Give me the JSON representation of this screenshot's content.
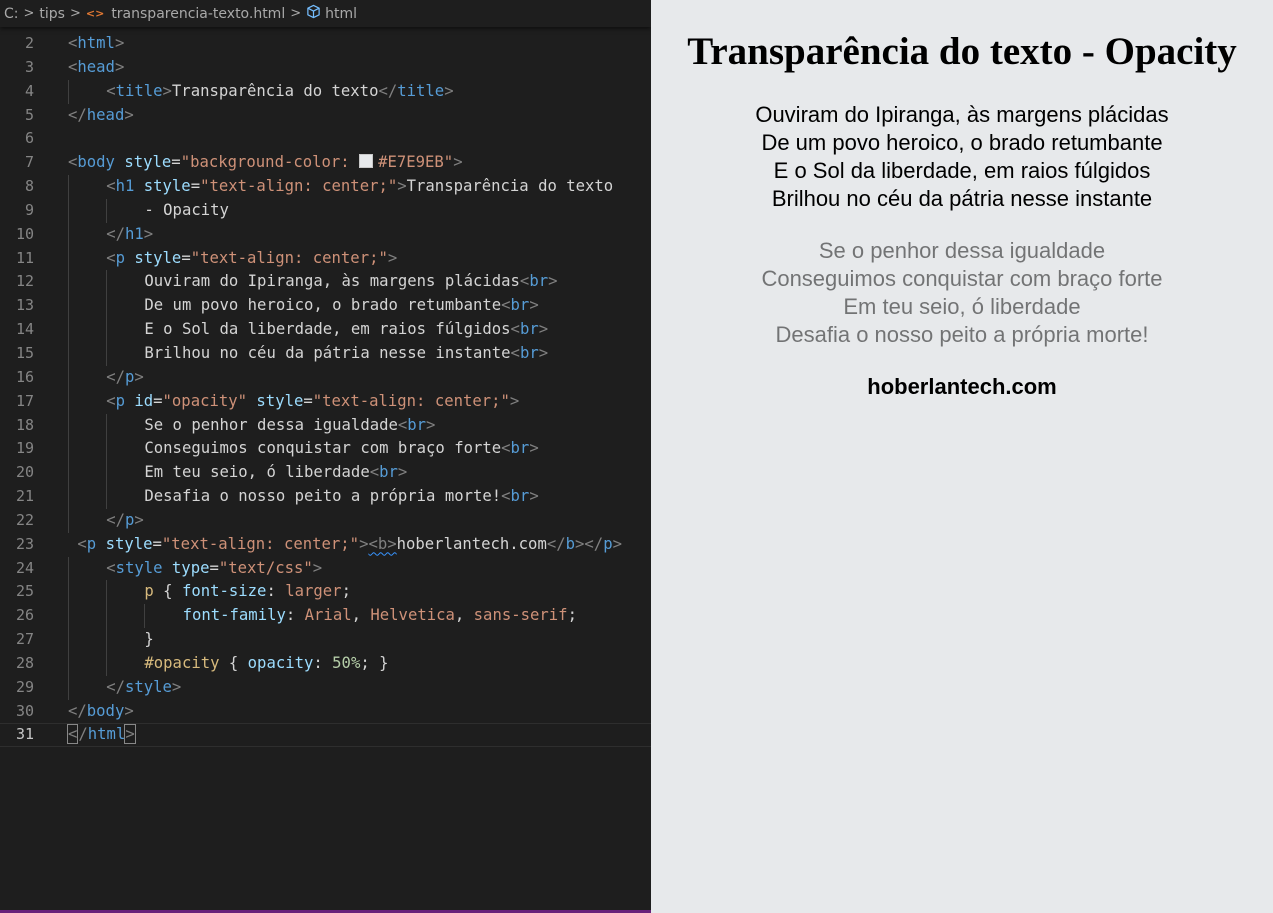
{
  "breadcrumb": {
    "drive": "C:",
    "folder": "tips",
    "file": "transparencia-texto.html",
    "symbol": "html"
  },
  "preview": {
    "heading": "Transparência do texto - Opacity",
    "stanza1": [
      "Ouviram do Ipiranga, às margens plácidas",
      "De um povo heroico, o brado retumbante",
      "E o Sol da liberdade, em raios fúlgidos",
      "Brilhou no céu da pátria nesse instante"
    ],
    "stanza2": [
      "Se o penhor dessa igualdade",
      "Conseguimos conquistar com braço forte",
      "Em teu seio, ó liberdade",
      "Desafia o nosso peito a própria morte!"
    ],
    "footer": "hoberlantech.com"
  },
  "colors": {
    "editor_bg": "#1e1e1e",
    "preview_bg": "#E7E9EB",
    "tag": "#569cd6",
    "attr": "#9cdcfe",
    "string": "#ce9178",
    "selector": "#d7ba7d"
  },
  "editor": {
    "current_line": 31,
    "lines": [
      {
        "n": "2",
        "i": 0,
        "tokens": [
          [
            "t-punc",
            "<"
          ],
          [
            "t-tag",
            "html"
          ],
          [
            "t-punc",
            ">"
          ]
        ]
      },
      {
        "n": "3",
        "i": 0,
        "tokens": [
          [
            "t-punc",
            "<"
          ],
          [
            "t-tag",
            "head"
          ],
          [
            "t-punc",
            ">"
          ]
        ]
      },
      {
        "n": "4",
        "i": 1,
        "tokens": [
          [
            "t-punc",
            "<"
          ],
          [
            "t-tag",
            "title"
          ],
          [
            "t-punc",
            ">"
          ],
          [
            "t-text",
            "Transparência do texto"
          ],
          [
            "t-punc",
            "</"
          ],
          [
            "t-tag",
            "title"
          ],
          [
            "t-punc",
            ">"
          ]
        ]
      },
      {
        "n": "5",
        "i": 0,
        "tokens": [
          [
            "t-punc",
            "</"
          ],
          [
            "t-tag",
            "head"
          ],
          [
            "t-punc",
            ">"
          ]
        ]
      },
      {
        "n": "6",
        "i": 0,
        "tokens": []
      },
      {
        "n": "7",
        "i": 0,
        "tokens": [
          [
            "t-punc",
            "<"
          ],
          [
            "t-tag",
            "body"
          ],
          [
            "t-text",
            " "
          ],
          [
            "t-attr",
            "style"
          ],
          [
            "t-text",
            "="
          ],
          [
            "t-str",
            "\"background-color: "
          ],
          [
            "swatch",
            ""
          ],
          [
            "t-str",
            "#E7E9EB\""
          ],
          [
            "t-punc",
            ">"
          ]
        ]
      },
      {
        "n": "8",
        "i": 1,
        "tokens": [
          [
            "t-punc",
            "<"
          ],
          [
            "t-tag",
            "h1"
          ],
          [
            "t-text",
            " "
          ],
          [
            "t-attr",
            "style"
          ],
          [
            "t-text",
            "="
          ],
          [
            "t-str",
            "\"text-align: center;\""
          ],
          [
            "t-punc",
            ">"
          ],
          [
            "t-text",
            "Transparência do texto"
          ]
        ]
      },
      {
        "n": "9",
        "i": 2,
        "tokens": [
          [
            "t-text",
            "- Opacity"
          ]
        ]
      },
      {
        "n": "10",
        "i": 1,
        "tokens": [
          [
            "t-punc",
            "</"
          ],
          [
            "t-tag",
            "h1"
          ],
          [
            "t-punc",
            ">"
          ]
        ]
      },
      {
        "n": "11",
        "i": 1,
        "tokens": [
          [
            "t-punc",
            "<"
          ],
          [
            "t-tag",
            "p"
          ],
          [
            "t-text",
            " "
          ],
          [
            "t-attr",
            "style"
          ],
          [
            "t-text",
            "="
          ],
          [
            "t-str",
            "\"text-align: center;\""
          ],
          [
            "t-punc",
            ">"
          ]
        ]
      },
      {
        "n": "12",
        "i": 2,
        "tokens": [
          [
            "t-text",
            "Ouviram do Ipiranga, às margens plácidas"
          ],
          [
            "t-punc",
            "<"
          ],
          [
            "t-tag",
            "br"
          ],
          [
            "t-punc",
            ">"
          ]
        ]
      },
      {
        "n": "13",
        "i": 2,
        "tokens": [
          [
            "t-text",
            "De um povo heroico, o brado retumbante"
          ],
          [
            "t-punc",
            "<"
          ],
          [
            "t-tag",
            "br"
          ],
          [
            "t-punc",
            ">"
          ]
        ]
      },
      {
        "n": "14",
        "i": 2,
        "tokens": [
          [
            "t-text",
            "E o Sol da liberdade, em raios fúlgidos"
          ],
          [
            "t-punc",
            "<"
          ],
          [
            "t-tag",
            "br"
          ],
          [
            "t-punc",
            ">"
          ]
        ]
      },
      {
        "n": "15",
        "i": 2,
        "tokens": [
          [
            "t-text",
            "Brilhou no céu da pátria nesse instante"
          ],
          [
            "t-punc",
            "<"
          ],
          [
            "t-tag",
            "br"
          ],
          [
            "t-punc",
            ">"
          ]
        ]
      },
      {
        "n": "16",
        "i": 1,
        "tokens": [
          [
            "t-punc",
            "</"
          ],
          [
            "t-tag",
            "p"
          ],
          [
            "t-punc",
            ">"
          ]
        ]
      },
      {
        "n": "17",
        "i": 1,
        "tokens": [
          [
            "t-punc",
            "<"
          ],
          [
            "t-tag",
            "p"
          ],
          [
            "t-text",
            " "
          ],
          [
            "t-attr",
            "id"
          ],
          [
            "t-text",
            "="
          ],
          [
            "t-str",
            "\"opacity\""
          ],
          [
            "t-text",
            " "
          ],
          [
            "t-attr",
            "style"
          ],
          [
            "t-text",
            "="
          ],
          [
            "t-str",
            "\"text-align: center;\""
          ],
          [
            "t-punc",
            ">"
          ]
        ]
      },
      {
        "n": "18",
        "i": 2,
        "tokens": [
          [
            "t-text",
            "Se o penhor dessa igualdade"
          ],
          [
            "t-punc",
            "<"
          ],
          [
            "t-tag",
            "br"
          ],
          [
            "t-punc",
            ">"
          ]
        ]
      },
      {
        "n": "19",
        "i": 2,
        "tokens": [
          [
            "t-text",
            "Conseguimos conquistar com braço forte"
          ],
          [
            "t-punc",
            "<"
          ],
          [
            "t-tag",
            "br"
          ],
          [
            "t-punc",
            ">"
          ]
        ]
      },
      {
        "n": "20",
        "i": 2,
        "tokens": [
          [
            "t-text",
            "Em teu seio, ó liberdade"
          ],
          [
            "t-punc",
            "<"
          ],
          [
            "t-tag",
            "br"
          ],
          [
            "t-punc",
            ">"
          ]
        ]
      },
      {
        "n": "21",
        "i": 2,
        "tokens": [
          [
            "t-text",
            "Desafia o nosso peito a própria morte!"
          ],
          [
            "t-punc",
            "<"
          ],
          [
            "t-tag",
            "br"
          ],
          [
            "t-punc",
            ">"
          ]
        ]
      },
      {
        "n": "22",
        "i": 1,
        "tokens": [
          [
            "t-punc",
            "</"
          ],
          [
            "t-tag",
            "p"
          ],
          [
            "t-punc",
            ">"
          ]
        ]
      },
      {
        "n": "23",
        "i": 0,
        "tokens": [
          [
            "t-text",
            " "
          ],
          [
            "t-punc",
            "<"
          ],
          [
            "t-tag",
            "p"
          ],
          [
            "t-text",
            " "
          ],
          [
            "t-attr",
            "style"
          ],
          [
            "t-text",
            "="
          ],
          [
            "t-str",
            "\"text-align: center;\""
          ],
          [
            "t-punc",
            ">"
          ],
          [
            "squiggle",
            "<b>"
          ],
          [
            "t-text",
            "hoberlantech.com"
          ],
          [
            "t-punc",
            "</"
          ],
          [
            "t-tag",
            "b"
          ],
          [
            "t-punc",
            "></"
          ],
          [
            "t-tag",
            "p"
          ],
          [
            "t-punc",
            ">"
          ]
        ]
      },
      {
        "n": "24",
        "i": 1,
        "tokens": [
          [
            "t-punc",
            "<"
          ],
          [
            "t-tag",
            "style"
          ],
          [
            "t-text",
            " "
          ],
          [
            "t-attr",
            "type"
          ],
          [
            "t-text",
            "="
          ],
          [
            "t-str",
            "\"text/css\""
          ],
          [
            "t-punc",
            ">"
          ]
        ]
      },
      {
        "n": "25",
        "i": 2,
        "tokens": [
          [
            "t-sel",
            "p"
          ],
          [
            "t-text",
            " { "
          ],
          [
            "t-attr",
            "font-size"
          ],
          [
            "t-text",
            ": "
          ],
          [
            "t-str",
            "larger"
          ],
          [
            "t-text",
            ";"
          ]
        ]
      },
      {
        "n": "26",
        "i": 3,
        "tokens": [
          [
            "t-attr",
            "font-family"
          ],
          [
            "t-text",
            ": "
          ],
          [
            "t-str",
            "Arial"
          ],
          [
            "t-text",
            ", "
          ],
          [
            "t-str",
            "Helvetica"
          ],
          [
            "t-text",
            ", "
          ],
          [
            "t-str",
            "sans-serif"
          ],
          [
            "t-text",
            ";"
          ]
        ]
      },
      {
        "n": "27",
        "i": 2,
        "tokens": [
          [
            "t-text",
            "}"
          ]
        ]
      },
      {
        "n": "28",
        "i": 2,
        "tokens": [
          [
            "t-sel",
            "#opacity"
          ],
          [
            "t-text",
            " { "
          ],
          [
            "t-attr",
            "opacity"
          ],
          [
            "t-text",
            ": "
          ],
          [
            "t-num",
            "50%"
          ],
          [
            "t-text",
            "; }"
          ]
        ]
      },
      {
        "n": "29",
        "i": 1,
        "tokens": [
          [
            "t-punc",
            "</"
          ],
          [
            "t-tag",
            "style"
          ],
          [
            "t-punc",
            ">"
          ]
        ]
      },
      {
        "n": "30",
        "i": 0,
        "tokens": [
          [
            "t-punc",
            "</"
          ],
          [
            "t-tag",
            "body"
          ],
          [
            "t-punc",
            ">"
          ]
        ]
      },
      {
        "n": "31",
        "i": 0,
        "tokens": [
          [
            "bm",
            "<"
          ],
          [
            "cursor",
            ""
          ],
          [
            "t-punc",
            "/"
          ],
          [
            "t-tag",
            "html"
          ],
          [
            "bm",
            ">"
          ]
        ]
      }
    ]
  }
}
